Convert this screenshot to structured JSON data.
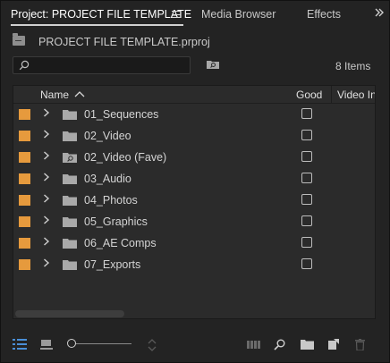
{
  "tabs": [
    {
      "label": "Project: PROJECT FILE TEMPLATE",
      "active": true
    },
    {
      "label": "Media Browser",
      "active": false
    },
    {
      "label": "Effects",
      "active": false
    }
  ],
  "project": {
    "filename": "PROJECT FILE TEMPLATE.prproj",
    "search_placeholder": "",
    "item_count": "8 Items"
  },
  "columns": {
    "name": "Name",
    "good": "Good",
    "video": "Video In"
  },
  "items": [
    {
      "label": "01_Sequences",
      "icon": "folder-icon"
    },
    {
      "label": "02_Video",
      "icon": "folder-icon"
    },
    {
      "label": "02_Video (Fave)",
      "icon": "search-bin-icon"
    },
    {
      "label": "03_Audio",
      "icon": "folder-icon"
    },
    {
      "label": "04_Photos",
      "icon": "folder-icon"
    },
    {
      "label": "05_Graphics",
      "icon": "folder-icon"
    },
    {
      "label": "06_AE Comps",
      "icon": "folder-icon"
    },
    {
      "label": "07_Exports",
      "icon": "folder-icon"
    }
  ],
  "colors": {
    "label_swatch": "#e69a3d",
    "list_view_active": "#4a8fd8"
  },
  "toolbar": {
    "icons": [
      "list-view-icon",
      "icon-view-icon",
      "zoom-slider",
      "sort-icon",
      "automate-to-sequence-icon",
      "find-icon",
      "new-bin-icon",
      "new-item-icon",
      "trash-icon"
    ]
  }
}
